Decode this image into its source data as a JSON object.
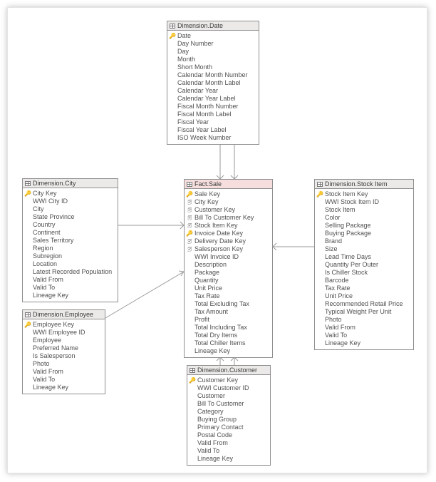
{
  "tables": {
    "date": {
      "title": "Dimension.Date",
      "fact": false,
      "cols": [
        {
          "icon": "pk",
          "name": "Date"
        },
        {
          "icon": "",
          "name": "Day Number"
        },
        {
          "icon": "",
          "name": "Day"
        },
        {
          "icon": "",
          "name": "Month"
        },
        {
          "icon": "",
          "name": "Short Month"
        },
        {
          "icon": "",
          "name": "Calendar Month Number"
        },
        {
          "icon": "",
          "name": "Calendar Month Label"
        },
        {
          "icon": "",
          "name": "Calendar Year"
        },
        {
          "icon": "",
          "name": "Calendar Year Label"
        },
        {
          "icon": "",
          "name": "Fiscal Month Number"
        },
        {
          "icon": "",
          "name": "Fiscal Month Label"
        },
        {
          "icon": "",
          "name": "Fiscal Year"
        },
        {
          "icon": "",
          "name": "Fiscal Year Label"
        },
        {
          "icon": "",
          "name": "ISO Week Number"
        }
      ]
    },
    "city": {
      "title": "Dimension.City",
      "fact": false,
      "cols": [
        {
          "icon": "pk",
          "name": "City Key"
        },
        {
          "icon": "",
          "name": "WWI City ID"
        },
        {
          "icon": "",
          "name": "City"
        },
        {
          "icon": "",
          "name": "State Province"
        },
        {
          "icon": "",
          "name": "Country"
        },
        {
          "icon": "",
          "name": "Continent"
        },
        {
          "icon": "",
          "name": "Sales Territory"
        },
        {
          "icon": "",
          "name": "Region"
        },
        {
          "icon": "",
          "name": "Subregion"
        },
        {
          "icon": "",
          "name": "Location"
        },
        {
          "icon": "",
          "name": "Latest Recorded Population"
        },
        {
          "icon": "",
          "name": "Valid From"
        },
        {
          "icon": "",
          "name": "Valid To"
        },
        {
          "icon": "",
          "name": "Lineage Key"
        }
      ]
    },
    "sale": {
      "title": "Fact.Sale",
      "fact": true,
      "cols": [
        {
          "icon": "pk",
          "name": "Sale Key"
        },
        {
          "icon": "fk",
          "name": "City Key"
        },
        {
          "icon": "fk",
          "name": "Customer Key"
        },
        {
          "icon": "fk",
          "name": "Bill To Customer Key"
        },
        {
          "icon": "fk",
          "name": "Stock Item Key"
        },
        {
          "icon": "pk",
          "name": "Invoice Date Key"
        },
        {
          "icon": "fk",
          "name": "Delivery Date Key"
        },
        {
          "icon": "fk",
          "name": "Salesperson Key"
        },
        {
          "icon": "",
          "name": "WWI Invoice ID"
        },
        {
          "icon": "",
          "name": "Description"
        },
        {
          "icon": "",
          "name": "Package"
        },
        {
          "icon": "",
          "name": "Quantity"
        },
        {
          "icon": "",
          "name": "Unit Price"
        },
        {
          "icon": "",
          "name": "Tax Rate"
        },
        {
          "icon": "",
          "name": "Total Excluding Tax"
        },
        {
          "icon": "",
          "name": "Tax Amount"
        },
        {
          "icon": "",
          "name": "Profit"
        },
        {
          "icon": "",
          "name": "Total Including Tax"
        },
        {
          "icon": "",
          "name": "Total Dry Items"
        },
        {
          "icon": "",
          "name": "Total Chiller Items"
        },
        {
          "icon": "",
          "name": "Lineage Key"
        }
      ]
    },
    "stock": {
      "title": "Dimension.Stock Item",
      "fact": false,
      "cols": [
        {
          "icon": "pk",
          "name": "Stock Item Key"
        },
        {
          "icon": "",
          "name": "WWI Stock Item ID"
        },
        {
          "icon": "",
          "name": "Stock Item"
        },
        {
          "icon": "",
          "name": "Color"
        },
        {
          "icon": "",
          "name": "Selling Package"
        },
        {
          "icon": "",
          "name": "Buying Package"
        },
        {
          "icon": "",
          "name": "Brand"
        },
        {
          "icon": "",
          "name": "Size"
        },
        {
          "icon": "",
          "name": "Lead Time Days"
        },
        {
          "icon": "",
          "name": "Quantity Per Outer"
        },
        {
          "icon": "",
          "name": "Is Chiller Stock"
        },
        {
          "icon": "",
          "name": "Barcode"
        },
        {
          "icon": "",
          "name": "Tax Rate"
        },
        {
          "icon": "",
          "name": "Unit Price"
        },
        {
          "icon": "",
          "name": "Recommended Retail Price"
        },
        {
          "icon": "",
          "name": "Typical Weight Per Unit"
        },
        {
          "icon": "",
          "name": "Photo"
        },
        {
          "icon": "",
          "name": "Valid From"
        },
        {
          "icon": "",
          "name": "Valid To"
        },
        {
          "icon": "",
          "name": "Lineage Key"
        }
      ]
    },
    "employee": {
      "title": "Dimension.Employee",
      "fact": false,
      "cols": [
        {
          "icon": "pk",
          "name": "Employee Key"
        },
        {
          "icon": "",
          "name": "WWI Employee ID"
        },
        {
          "icon": "",
          "name": "Employee"
        },
        {
          "icon": "",
          "name": "Preferred Name"
        },
        {
          "icon": "",
          "name": "Is Salesperson"
        },
        {
          "icon": "",
          "name": "Photo"
        },
        {
          "icon": "",
          "name": "Valid From"
        },
        {
          "icon": "",
          "name": "Valid To"
        },
        {
          "icon": "",
          "name": "Lineage Key"
        }
      ]
    },
    "customer": {
      "title": "Dimension.Customer",
      "fact": false,
      "cols": [
        {
          "icon": "pk",
          "name": "Customer Key"
        },
        {
          "icon": "",
          "name": "WWI Customer ID"
        },
        {
          "icon": "",
          "name": "Customer"
        },
        {
          "icon": "",
          "name": "Bill To Customer"
        },
        {
          "icon": "",
          "name": "Category"
        },
        {
          "icon": "",
          "name": "Buying Group"
        },
        {
          "icon": "",
          "name": "Primary Contact"
        },
        {
          "icon": "",
          "name": "Postal Code"
        },
        {
          "icon": "",
          "name": "Valid From"
        },
        {
          "icon": "",
          "name": "Valid To"
        },
        {
          "icon": "",
          "name": "Lineage Key"
        }
      ]
    }
  }
}
